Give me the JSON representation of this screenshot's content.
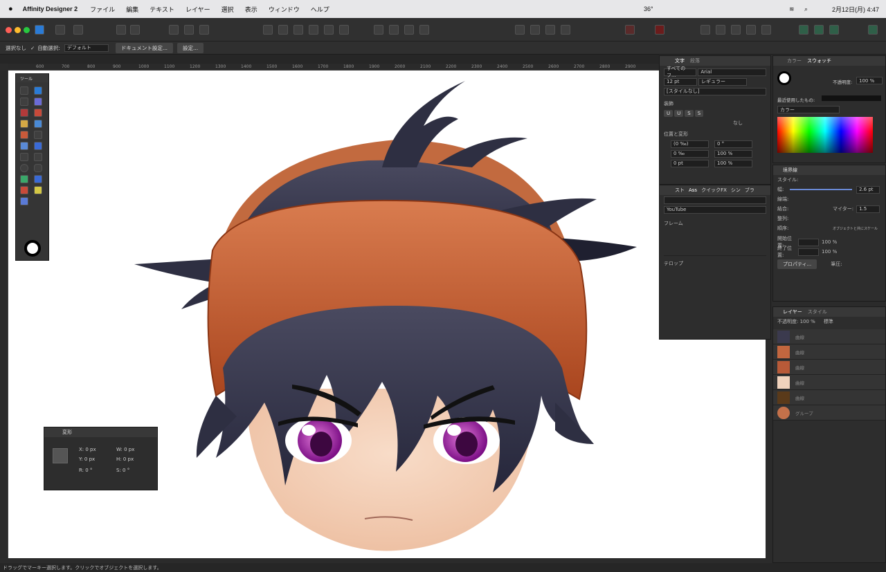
{
  "menubar": {
    "app": "Affinity Designer 2",
    "items": [
      "ファイル",
      "編集",
      "テキスト",
      "レイヤー",
      "選択",
      "表示",
      "ウィンドウ",
      "ヘルプ"
    ],
    "temp": "36°",
    "clock": "2月12日(月) 4:47"
  },
  "context": {
    "select_none": "選択なし",
    "auto_select": "自動選択:",
    "default": "デフォルト",
    "doc_setup": "ドキュメント設定...",
    "settings": "設定..."
  },
  "ruler": {
    "ticks": [
      "600",
      "700",
      "800",
      "900",
      "1000",
      "1100",
      "1200",
      "1300",
      "1400",
      "1500",
      "1600",
      "1700",
      "1800",
      "1900",
      "2000",
      "2100",
      "2200",
      "2300",
      "2400",
      "2500",
      "2600",
      "2700",
      "2800",
      "2900"
    ]
  },
  "tools": {
    "title": "ツール"
  },
  "transform": {
    "tab": "変形",
    "x": "X: 0 px",
    "y": "Y: 0 px",
    "w": "W: 0 px",
    "h": "H: 0 px",
    "r": "R: 0 °",
    "s": "S: 0 °"
  },
  "character": {
    "tabs": [
      "文字",
      "段落"
    ],
    "font_collection": "すべてのフ...",
    "font": "Arial",
    "size": "12 pt",
    "weight": "レギュラー",
    "style": "[スタイルなし]",
    "deco_header": "装飾",
    "none": "なし",
    "pos_header": "位置と変形",
    "kern": "(0 ‰)",
    "track": "0 ‰",
    "base": "0 pt",
    "angle": "0 °",
    "scale1": "100 %",
    "scale2": "100 %"
  },
  "assets": {
    "tabs": [
      "スト",
      "Ass",
      "クイックFX",
      "シン",
      "ブラ"
    ],
    "category": "YouTube",
    "group1": "フレーム",
    "group2": "テロップ"
  },
  "swatches": {
    "tabs": [
      "カラー",
      "スウォッチ"
    ],
    "opacity_label": "不透明度:",
    "opacity": "100 %",
    "recent": "最近使用したもの:",
    "palette": "カラー"
  },
  "stroke": {
    "tab": "境界線",
    "style_label": "スタイル:",
    "width_label": "幅:",
    "width": "2.6 pt",
    "cap": "線端:",
    "join": "結合:",
    "miter_label": "マイター:",
    "miter": "1.5",
    "align": "整列:",
    "order": "順序:",
    "scale_check": "オブジェクトと共にスケール",
    "start": "開始位置:",
    "end": "終了位置:",
    "pct1": "100 %",
    "pct2": "100 %",
    "props": "プロパティ...",
    "pressure": "筆圧:"
  },
  "layers": {
    "tabs": [
      "レイヤー",
      "スタイル"
    ],
    "opacity": "不透明度: 100 %",
    "blend": "標準",
    "items": [
      {
        "name": "曲線",
        "color": "#3b3a4e"
      },
      {
        "name": "曲線",
        "color": "#c2663f"
      },
      {
        "name": "曲線",
        "color": "#b85a38"
      },
      {
        "name": "曲線",
        "color": "#f0d2bc"
      },
      {
        "name": "曲線",
        "color": "#5a3a1a"
      },
      {
        "name": "グループ",
        "color": "#c4714a"
      }
    ]
  },
  "status": {
    "text": "ドラッグでマーキー選択します。クリックでオブジェクトを選択します。"
  }
}
